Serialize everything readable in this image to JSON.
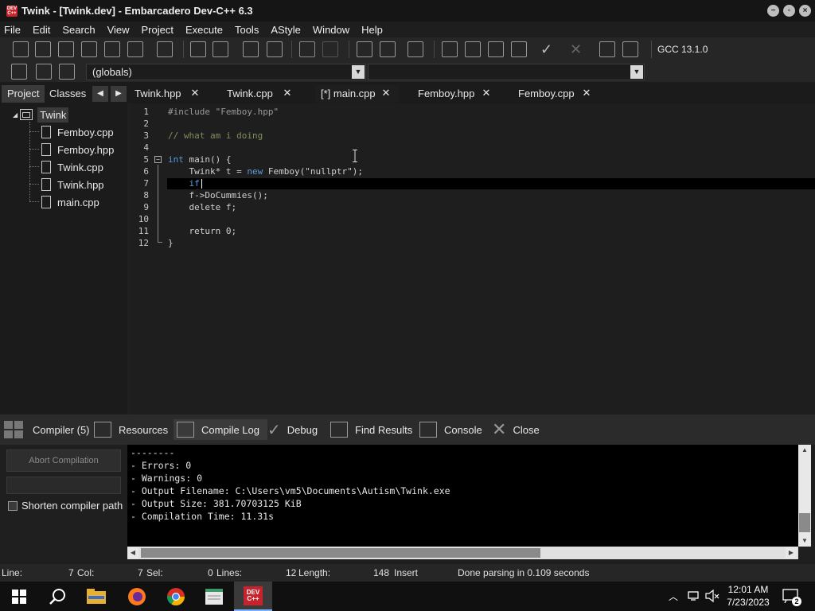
{
  "window": {
    "title": "Twink - [Twink.dev] - Embarcadero Dev-C++ 6.3",
    "icon_text": "DEV C++"
  },
  "menu": [
    "File",
    "Edit",
    "Search",
    "View",
    "Project",
    "Execute",
    "Tools",
    "AStyle",
    "Window",
    "Help"
  ],
  "toolbar": {
    "compiler": "GCC 13.1.0",
    "scope_select": "(globals)",
    "function_select": ""
  },
  "left_panel": {
    "tabs": [
      "Project",
      "Classes"
    ],
    "active_tab": "Project",
    "project_name": "Twink",
    "files": [
      "Femboy.cpp",
      "Femboy.hpp",
      "Twink.cpp",
      "Twink.hpp",
      "main.cpp"
    ]
  },
  "editor_tabs": [
    {
      "label": "Twink.hpp",
      "active": false
    },
    {
      "label": "Twink.cpp",
      "active": false
    },
    {
      "label": "[*] main.cpp",
      "active": true
    },
    {
      "label": "Femboy.hpp",
      "active": false
    },
    {
      "label": "Femboy.cpp",
      "active": false
    }
  ],
  "editor": {
    "line_numbers": [
      "1",
      "2",
      "3",
      "4",
      "5",
      "6",
      "7",
      "8",
      "9",
      "10",
      "11",
      "12"
    ],
    "lines": [
      "#include \"Femboy.hpp\"",
      "",
      "// what am i doing",
      "",
      "int main() {",
      "    Twink* t = new Femboy(\"nullptr\");",
      "    if",
      "    f->DoCummies();",
      "    delete f;",
      "",
      "    return 0;",
      "}"
    ],
    "current_line": 7
  },
  "bottom_tabs": [
    {
      "label": "Compiler (5)",
      "icon": "grid-icon",
      "active": false
    },
    {
      "label": "Resources",
      "icon": "resources-icon",
      "active": false
    },
    {
      "label": "Compile Log",
      "icon": "chart-icon",
      "active": true
    },
    {
      "label": "Debug",
      "icon": "check-icon",
      "active": false
    },
    {
      "label": "Find Results",
      "icon": "search-doc-icon",
      "active": false
    },
    {
      "label": "Console",
      "icon": "console-icon",
      "active": false
    },
    {
      "label": "Close",
      "icon": "close-x-icon",
      "active": false
    }
  ],
  "compile_panel": {
    "abort_label": "Abort Compilation",
    "shorten_label": "Shorten compiler path",
    "shorten_checked": false,
    "log": [
      "--------",
      "- Errors: 0",
      "- Warnings: 0",
      "- Output Filename: C:\\Users\\vm5\\Documents\\Autism\\Twink.exe",
      "- Output Size: 381.70703125 KiB",
      "- Compilation Time: 11.31s"
    ]
  },
  "statusbar": {
    "line_label": "Line:",
    "line_value": "7",
    "col_label": "Col:",
    "col_value": "7",
    "sel_label": "Sel:",
    "sel_value": "0",
    "lines_label": "Lines:",
    "lines_value": "12",
    "length_label": "Length:",
    "length_value": "148",
    "mode": "Insert",
    "message": "Done parsing in 0.109 seconds"
  },
  "taskbar": {
    "apps": [
      "start",
      "search",
      "file-explorer",
      "firefox",
      "chrome",
      "notepad",
      "devcpp"
    ],
    "time": "12:01 AM",
    "date": "7/23/2023",
    "notification_count": "2"
  }
}
